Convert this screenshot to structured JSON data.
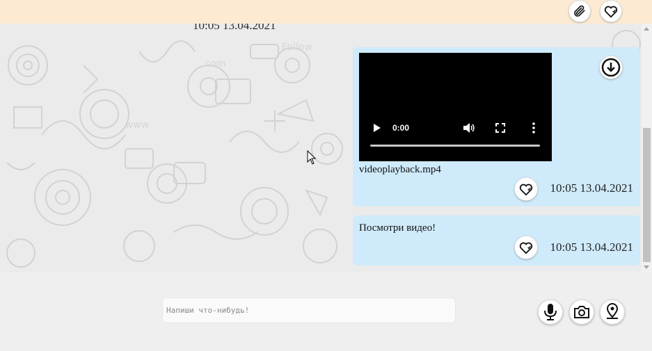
{
  "header": {
    "previous_time": "10:05 13.04.2021",
    "attach_icon": "paperclip-icon",
    "favorites_icon": "heart-icon"
  },
  "messages": [
    {
      "type": "video",
      "video_time": "0:00",
      "file_name": "videoplayback.mp4",
      "time": "10:05 13.04.2021",
      "download_icon": "download-icon",
      "like_icon": "heart-icon"
    },
    {
      "type": "text",
      "text": "Посмотри видео!",
      "time": "10:05 13.04.2021",
      "like_icon": "heart-icon"
    }
  ],
  "composer": {
    "placeholder": "Напиши что-нибудь!",
    "mic_icon": "microphone-icon",
    "camera_icon": "camera-icon",
    "location_icon": "location-pin-icon"
  },
  "colors": {
    "header_bg": "#fcebd2",
    "bubble_bg": "#cfeafa",
    "chat_bg": "#ececec"
  }
}
